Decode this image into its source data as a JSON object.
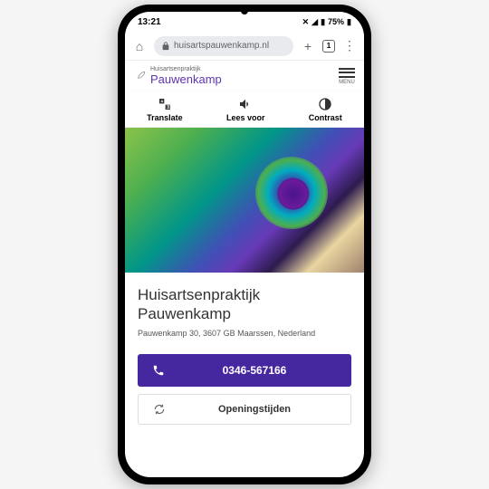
{
  "status": {
    "time": "13:21",
    "battery": "75%"
  },
  "browser": {
    "url": "huisartspauwenkamp.nl",
    "tabs": "1"
  },
  "site": {
    "tagline": "Huisartsenpraktijk",
    "name": "Pauwenkamp",
    "menu": "MENU"
  },
  "toolbar": {
    "translate": "Translate",
    "readaloud": "Lees voor",
    "contrast": "Contrast"
  },
  "main": {
    "title": "Huisartsenpraktijk Pauwenkamp",
    "address": "Pauwenkamp 30, 3607 GB Maarssen, Nederland",
    "phone": "0346-567166",
    "hours": "Openingstijden"
  }
}
